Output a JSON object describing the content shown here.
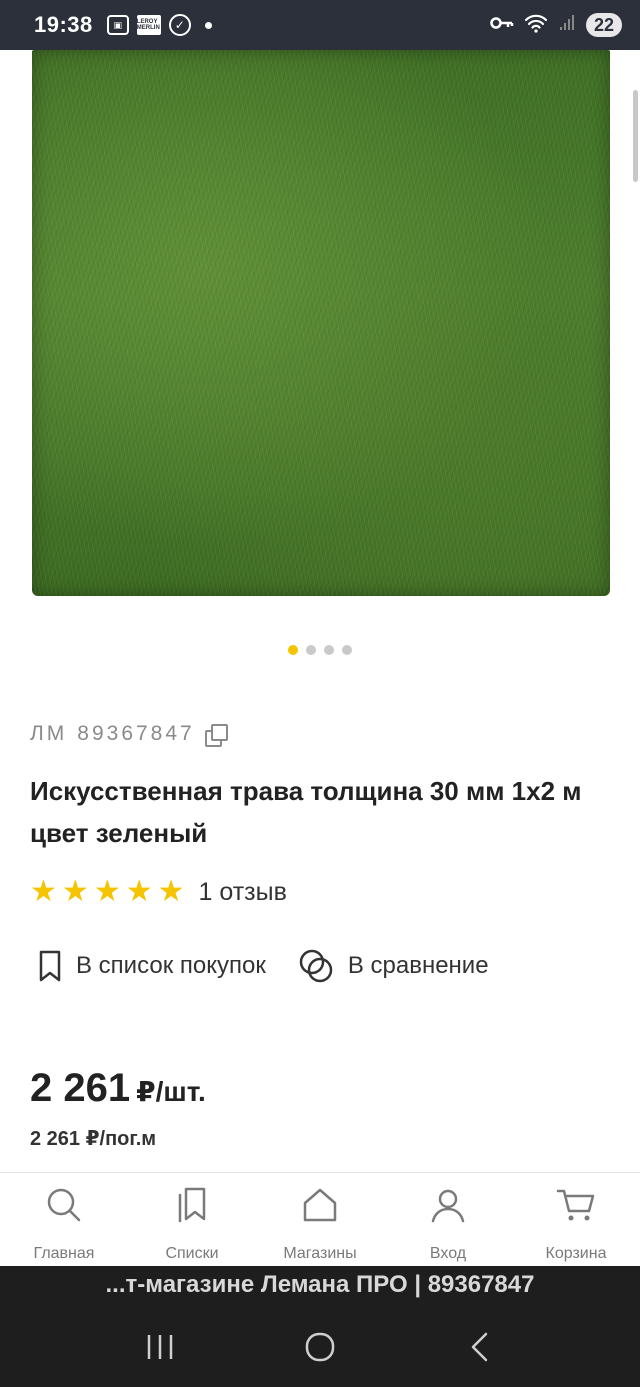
{
  "status_bar": {
    "time": "19:38",
    "lm_badge": "LEROY MERLIN",
    "battery": "22"
  },
  "gallery": {
    "image_icon": "artificial-grass-photo",
    "slides_total": 4,
    "active_slide": 1
  },
  "product": {
    "article_prefix": "ЛМ",
    "article_number": "89367847",
    "title": "Искусственная трава толщина 30 мм 1х2 м цвет зеленый",
    "rating": 5,
    "rating_max": 5,
    "reviews": "1 отзыв"
  },
  "actions": {
    "shopping_list": "В список покупок",
    "compare": "В сравнение"
  },
  "price": {
    "main": "2 261",
    "main_unit": "₽/шт.",
    "secondary": "2 261 ₽/пог.м"
  },
  "bottom_nav": {
    "items": [
      {
        "label": "Главная",
        "icon": "search-icon"
      },
      {
        "label": "Списки",
        "icon": "bookmarks-icon"
      },
      {
        "label": "Магазины",
        "icon": "store-icon"
      },
      {
        "label": "Вход",
        "icon": "user-icon"
      },
      {
        "label": "Корзина",
        "icon": "cart-icon"
      }
    ]
  },
  "url_banner": "...т-магазине Лемана ПРО | 89367847",
  "colors": {
    "accent": "#f5c400",
    "status_bar": "#2c303a",
    "system_nav": "#1e1e1e"
  }
}
